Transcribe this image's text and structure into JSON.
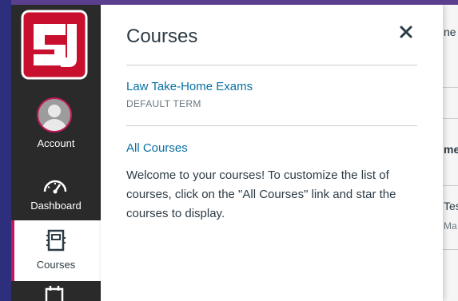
{
  "nav": {
    "logo_text": "SU",
    "account_label": "Account",
    "dashboard_label": "Dashboard",
    "courses_label": "Courses"
  },
  "tray": {
    "title": "Courses",
    "course": {
      "name": "Law Take-Home Exams",
      "term": "DEFAULT TERM"
    },
    "all_courses_link": "All Courses",
    "welcome_text": "Welcome to your courses! To customize the list of courses, click on the \"All Courses\" link and star the courses to display."
  },
  "background": {
    "text_1": "ne",
    "text_2": "me",
    "text_3": "Tes",
    "text_4": "Ma"
  },
  "colors": {
    "nav_bg": "#2a2a2a",
    "brand_red": "#c8102e",
    "accent_pink": "#c2185b",
    "link_blue": "#0770a3"
  }
}
